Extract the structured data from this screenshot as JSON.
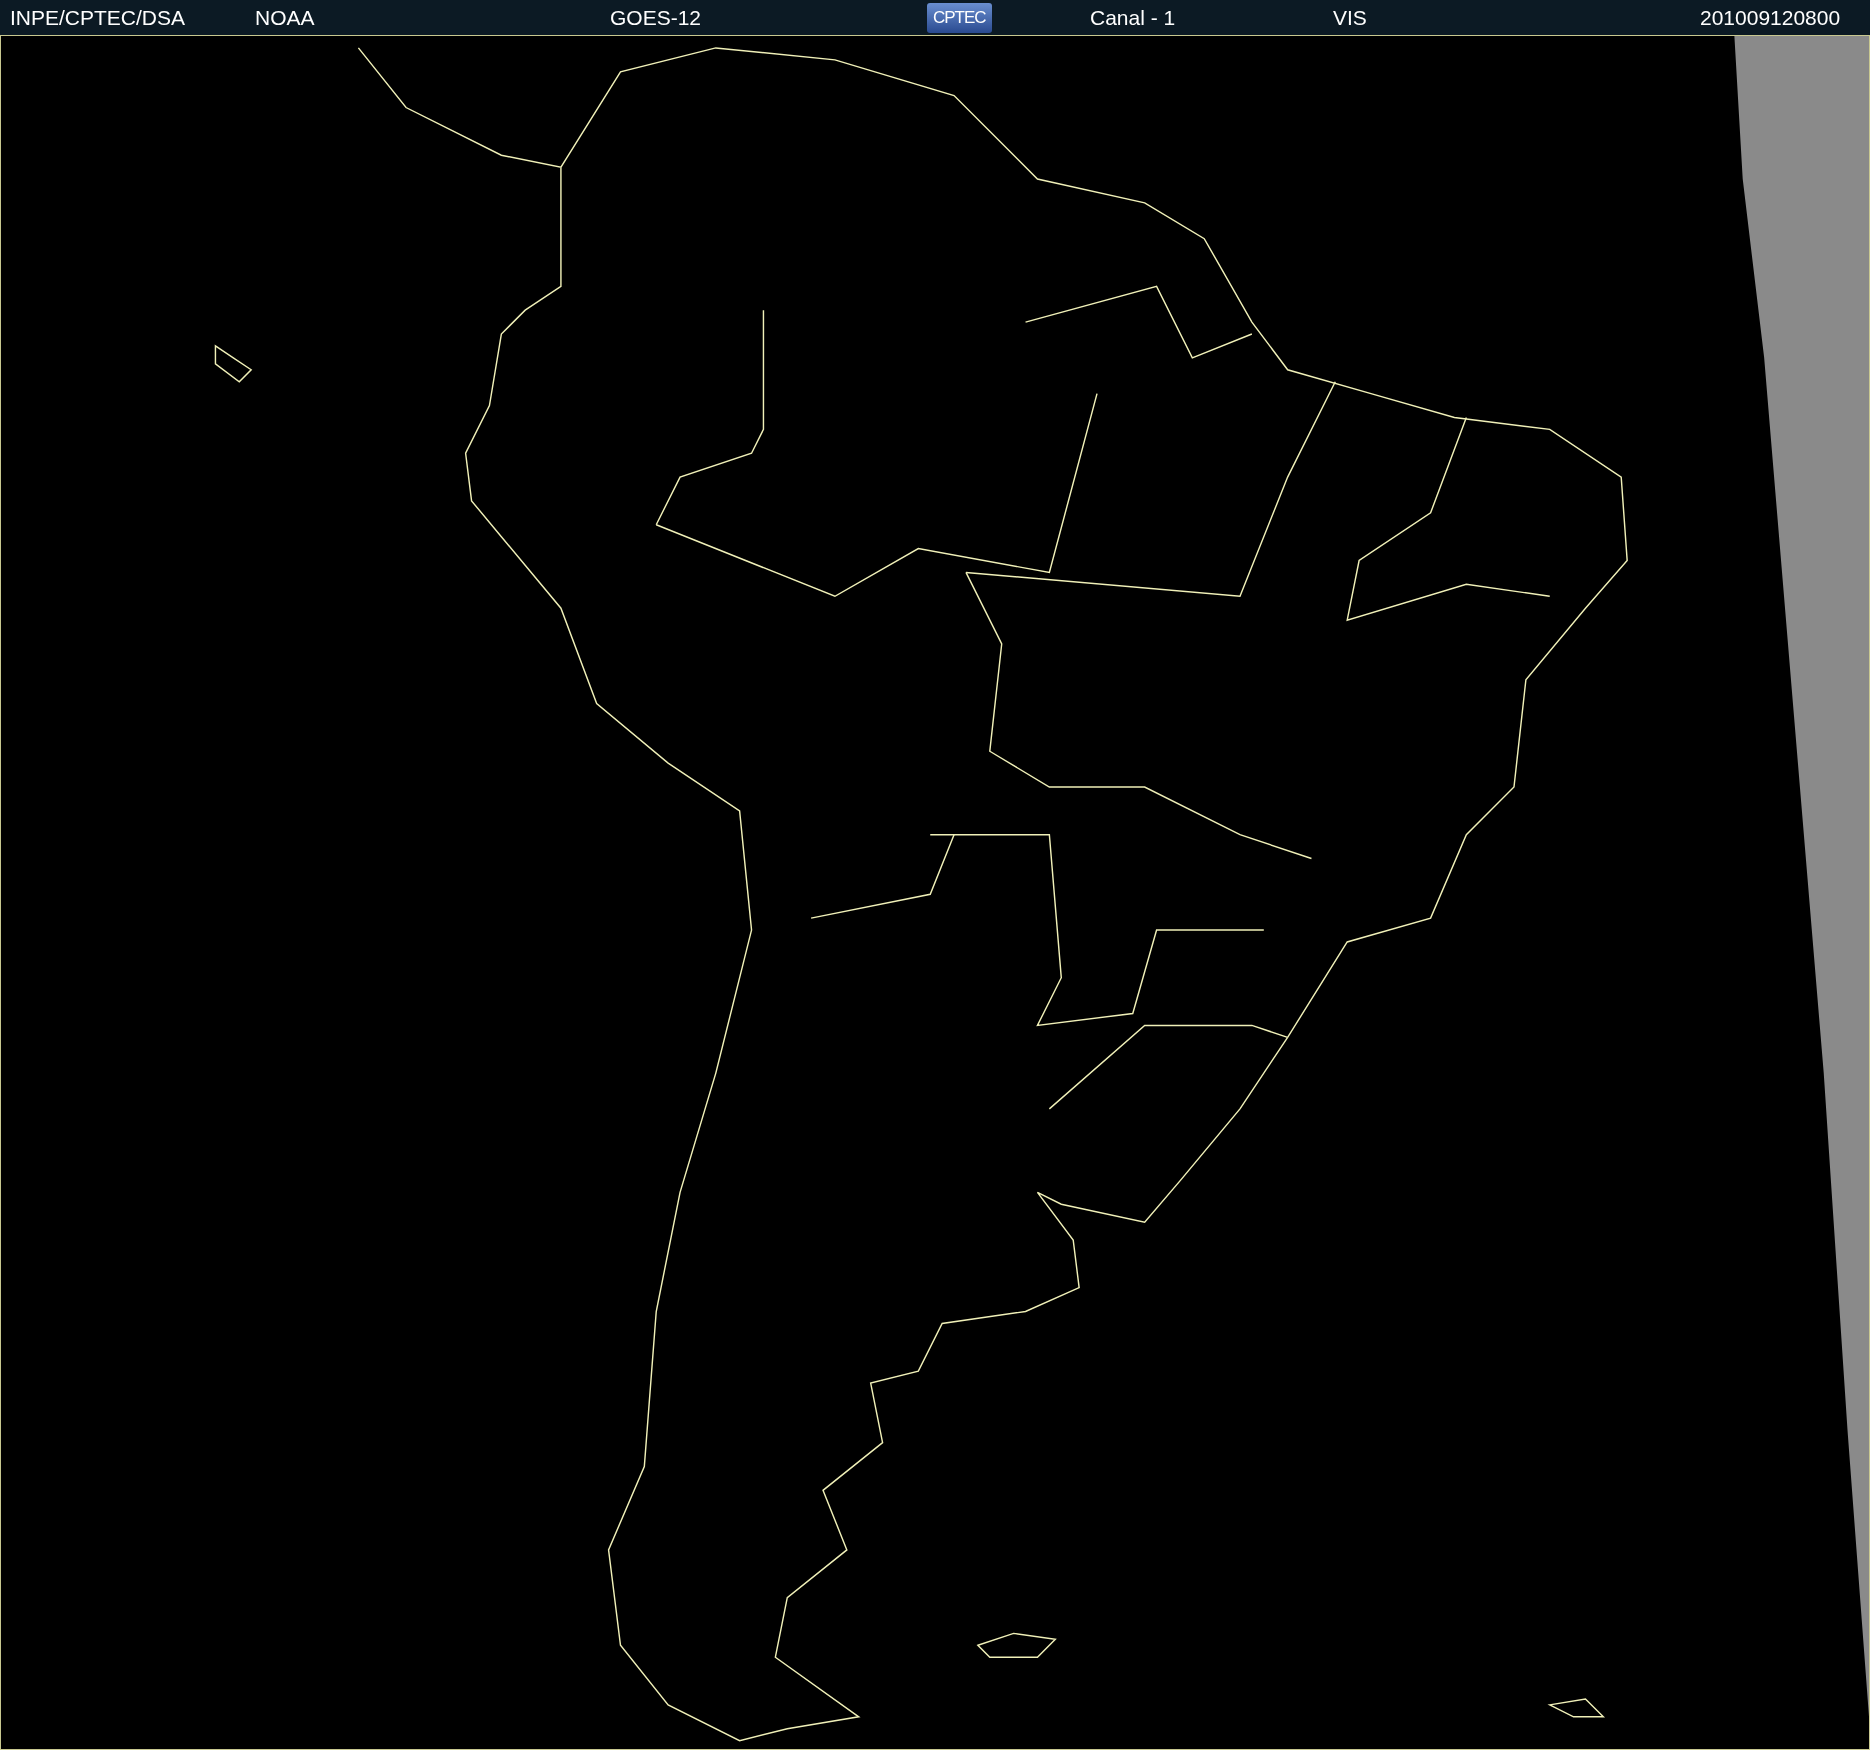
{
  "header": {
    "items": [
      {
        "kind": "text",
        "text": "INPE/CPTEC/DSA"
      },
      {
        "kind": "text",
        "text": "NOAA"
      },
      {
        "kind": "text",
        "text": "GOES-12"
      },
      {
        "kind": "logo",
        "text": "CPTEC"
      },
      {
        "kind": "text",
        "text": "Canal - 1"
      },
      {
        "kind": "text",
        "text": "VIS"
      },
      {
        "kind": "text",
        "text": "201009120800"
      }
    ]
  }
}
